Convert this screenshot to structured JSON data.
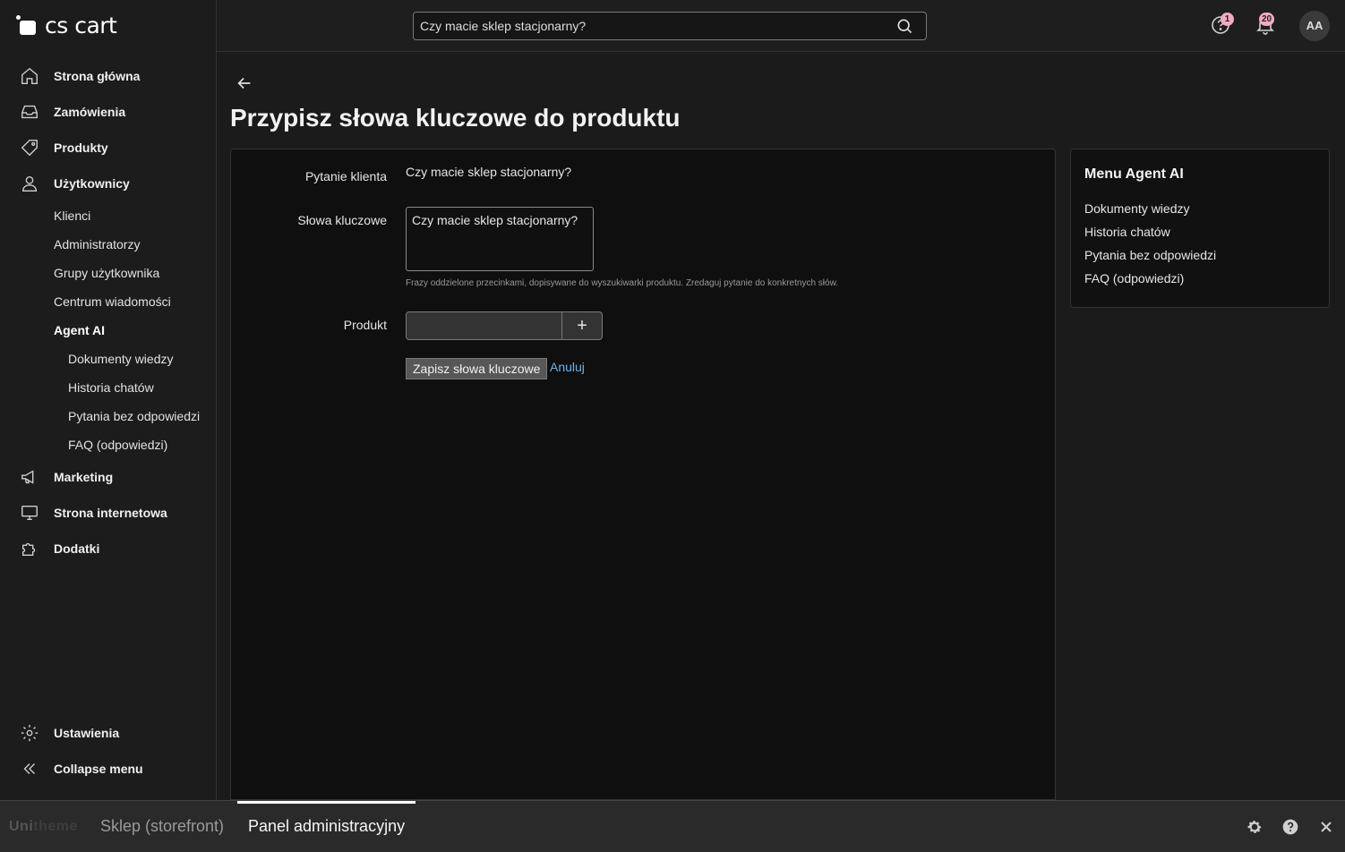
{
  "logo": {
    "text": "cs cart"
  },
  "sidebar": {
    "items": [
      {
        "label": "Strona główna",
        "icon": "home-icon"
      },
      {
        "label": "Zamówienia",
        "icon": "inbox-icon"
      },
      {
        "label": "Produkty",
        "icon": "tag-icon"
      },
      {
        "label": "Użytkownicy",
        "icon": "user-icon"
      }
    ],
    "users_sub": [
      "Klienci",
      "Administratorzy",
      "Grupy użytkownika",
      "Centrum wiadomości",
      "Agent AI"
    ],
    "agent_sub": [
      "Dokumenty wiedzy",
      "Historia chatów",
      "Pytania bez odpowiedzi",
      "FAQ (odpowiedzi)"
    ],
    "items2": [
      {
        "label": "Marketing",
        "icon": "megaphone-icon"
      },
      {
        "label": "Strona internetowa",
        "icon": "monitor-icon"
      },
      {
        "label": "Dodatki",
        "icon": "puzzle-icon"
      }
    ],
    "settings": "Ustawienia",
    "collapse": "Collapse menu"
  },
  "topbar": {
    "search_value": "Czy macie sklep stacjonarny?",
    "help_badge": "1",
    "notif_badge": "20",
    "avatar": "AA"
  },
  "page": {
    "title": "Przypisz słowa kluczowe do produktu",
    "form": {
      "question_label": "Pytanie klienta",
      "question_value": "Czy macie sklep stacjonarny?",
      "keywords_label": "Słowa kluczowe",
      "keywords_value": "Czy macie sklep stacjonarny?",
      "keywords_hint": "Frazy oddzielone przecinkami, dopisywane do wyszukiwarki produktu. Zredaguj pytanie do konkretnych słów.",
      "product_label": "Produkt",
      "product_add": "+",
      "save_label": "Zapisz słowa kluczowe",
      "cancel_label": "Anuluj"
    },
    "side_menu": {
      "title": "Menu Agent AI",
      "links": [
        "Dokumenty wiedzy",
        "Historia chatów",
        "Pytania bez odpowiedzi",
        "FAQ (odpowiedzi)"
      ]
    }
  },
  "bottombar": {
    "logo_a": "Uni",
    "logo_b": "theme",
    "tab_store": "Sklep (storefront)",
    "tab_admin": "Panel administracyjny"
  }
}
